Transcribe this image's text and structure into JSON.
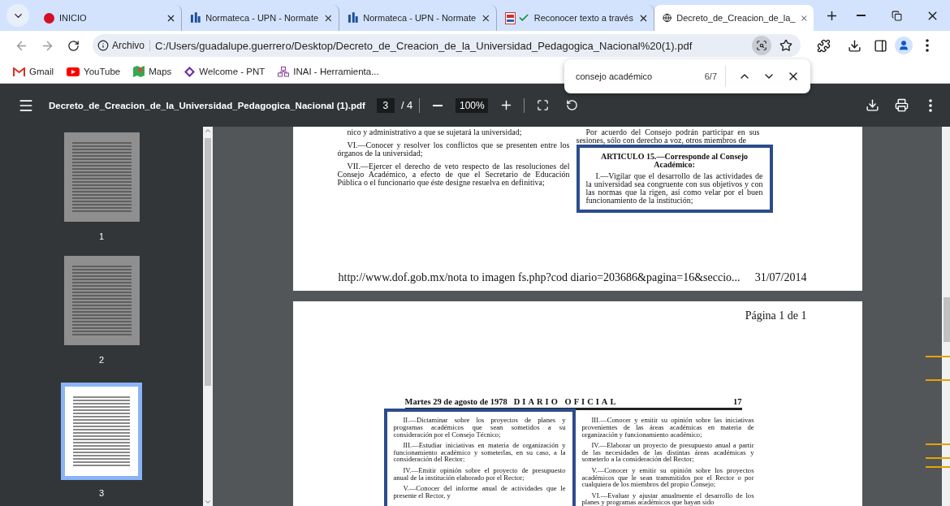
{
  "tabs": [
    {
      "title": "INICIO",
      "selected": false
    },
    {
      "title": "Normateca - UPN - Normate",
      "selected": false
    },
    {
      "title": "Normateca - UPN - Normate",
      "selected": false
    },
    {
      "title": "Reconocer texto a través",
      "selected": false
    },
    {
      "title": "Decreto_de_Creacion_de_la_",
      "selected": true
    }
  ],
  "address": {
    "chip": "Archivo",
    "url": "C:/Users/guadalupe.guerrero/Desktop/Decreto_de_Creacion_de_la_Universidad_Pedagogica_Nacional%20(1).pdf"
  },
  "bookmarks": [
    {
      "label": "Gmail"
    },
    {
      "label": "YouTube"
    },
    {
      "label": "Maps"
    },
    {
      "label": "Welcome - PNT"
    },
    {
      "label": "INAI - Herramienta..."
    }
  ],
  "find_bar": {
    "query": "consejo académico",
    "count": "6/7"
  },
  "pdf_toolbar": {
    "title": "Decreto_de_Creacion_de_la_Universidad_Pedagogica_Nacional (1).pdf",
    "page": "3",
    "page_total": "/ 4",
    "zoom": "100%"
  },
  "thumbnails": [
    {
      "label": "1",
      "selected": false
    },
    {
      "label": "2",
      "selected": false
    },
    {
      "label": "3",
      "selected": true
    }
  ],
  "pages": [
    {
      "columns": [
        {
          "highlighted": false,
          "paragraphs": [
            {
              "kind": "text",
              "text": "nico y administrativo a que se sujetará la universidad;"
            },
            {
              "kind": "text",
              "text": "VI.—Conocer y resolver los conflictos que se presenten entre los órganos de la universidad;"
            },
            {
              "kind": "text",
              "text": "VII.—Ejercer el derecho de veto respecto de las resoluciones del Consejo Académico, a efecto de que el Secretario de Educación Pública o el funcionario que éste designe resuelva en definitiva;"
            }
          ]
        },
        {
          "highlighted": false,
          "paragraphs": [
            {
              "kind": "text",
              "text": "Por acuerdo del Consejo podrán participar en sus sesiones, sólo con derecho a voz, otros miembros de"
            }
          ]
        },
        {
          "highlighted": true,
          "paragraphs": [
            {
              "kind": "heading",
              "text": "ARTICULO 15.—Corresponde al Consejo Académico:"
            },
            {
              "kind": "text",
              "text": "I.—Vigilar que el desarrollo de las actividades de la universidad sea congruente con sus objetivos y con las normas que la rigen, así como velar por el buen funcionamiento de la institución;"
            }
          ]
        }
      ],
      "footer_link": "http://www.dof.gob.mx/nota to imagen fs.php?cod diario=203686&pagina=16&seccio...",
      "footer_date": "31/07/2014"
    },
    {
      "page_label": "Página 1 de 1",
      "header": {
        "date": "Martes 29 de agosto de 1978",
        "paper": "DIARIO OFICIAL",
        "number": "17"
      },
      "columns": [
        {
          "highlighted": true,
          "paragraphs": [
            {
              "kind": "text",
              "text": "II.—Dictaminar sobre los proyectos de planes y programas académicos que sean sometidos a su consideración por el Consejo Técnico;"
            },
            {
              "kind": "text",
              "text": "III.—Estudiar iniciativas en materia de organización y funcionamiento académico y someterlas, en su caso, a la consideración del Rector;"
            },
            {
              "kind": "text",
              "text": "IV.—Emitir opinión sobre el proyecto de presupuesto anual de la institución elaborado por el Rector;"
            },
            {
              "kind": "text",
              "text": "V.—Conocer del informe anual de actividades que le presente el Rector, y"
            }
          ]
        },
        {
          "highlighted": false,
          "paragraphs": [
            {
              "kind": "text",
              "text": "III.—Conocer y emitir su opinión sobre las iniciativas provenientes de las áreas académicas en materia de organización y funcionamiento académico;"
            },
            {
              "kind": "text",
              "text": "IV.—Elaborar un proyecto de presupuesto anual a partir de las necesidades de las distintas áreas académicas y someterlo a la consideración del Rector;"
            },
            {
              "kind": "text",
              "text": "V.—Conocer y emitir su opinión sobre los proyectos académicos que le sean transmitidos por el Rector o por cualquiera de los miembros del propio Consejo;"
            },
            {
              "kind": "text",
              "text": "VI.—Evaluar y ajustar anualmente el desarrollo de los planes y programas académicos que hayan sido"
            }
          ]
        }
      ]
    }
  ]
}
